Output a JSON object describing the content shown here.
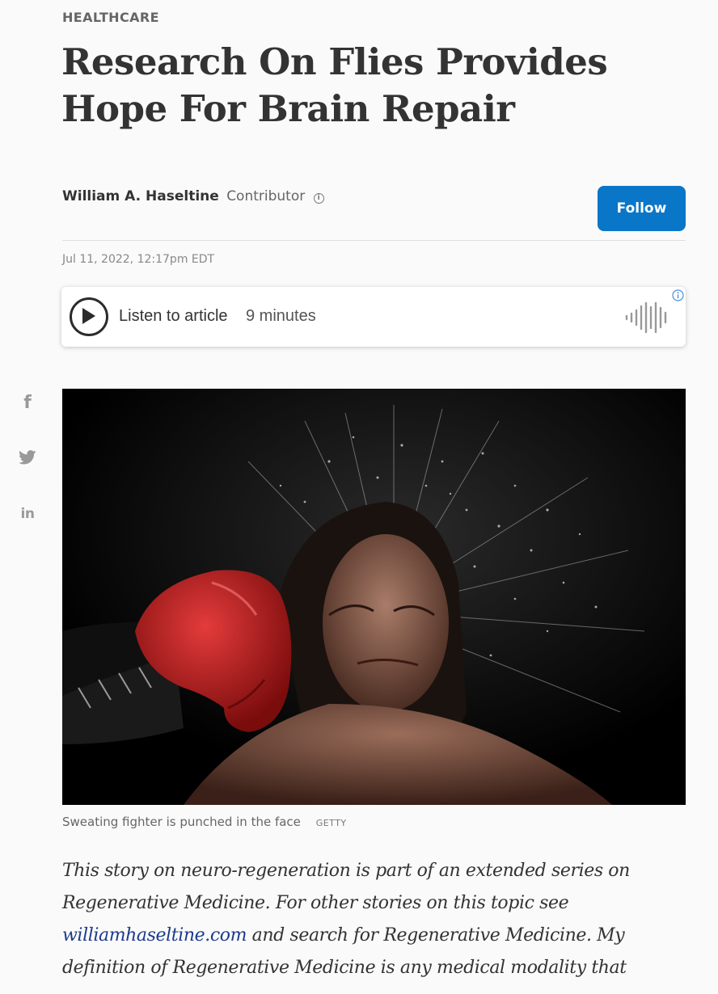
{
  "article": {
    "category": "HEALTHCARE",
    "headline": "Research On Flies Provides Hope For Brain Repair",
    "author_name": "William A. Haseltine",
    "author_role": "Contributor",
    "follow_label": "Follow",
    "published": "Jul 11, 2022, 12:17pm EDT"
  },
  "audio": {
    "listen_label": "Listen to article",
    "duration": "9 minutes"
  },
  "share": {
    "facebook_glyph": "f",
    "linkedin_glyph": "in"
  },
  "image": {
    "caption": "Sweating fighter is punched in the face",
    "credit": "GETTY"
  },
  "body": {
    "intro_before_link": "This story on neuro-regeneration is part of an extended series on Regenerative Medicine. For other stories on this topic see ",
    "link_text": "williamhaseltine.com",
    "intro_after_link": " and search for Regenerative Medicine. My definition of Regenerative Medicine is any medical modality that"
  },
  "colors": {
    "follow_button": "#0a76c8",
    "link": "#1b3b8c",
    "glove": "#c41a1a"
  }
}
